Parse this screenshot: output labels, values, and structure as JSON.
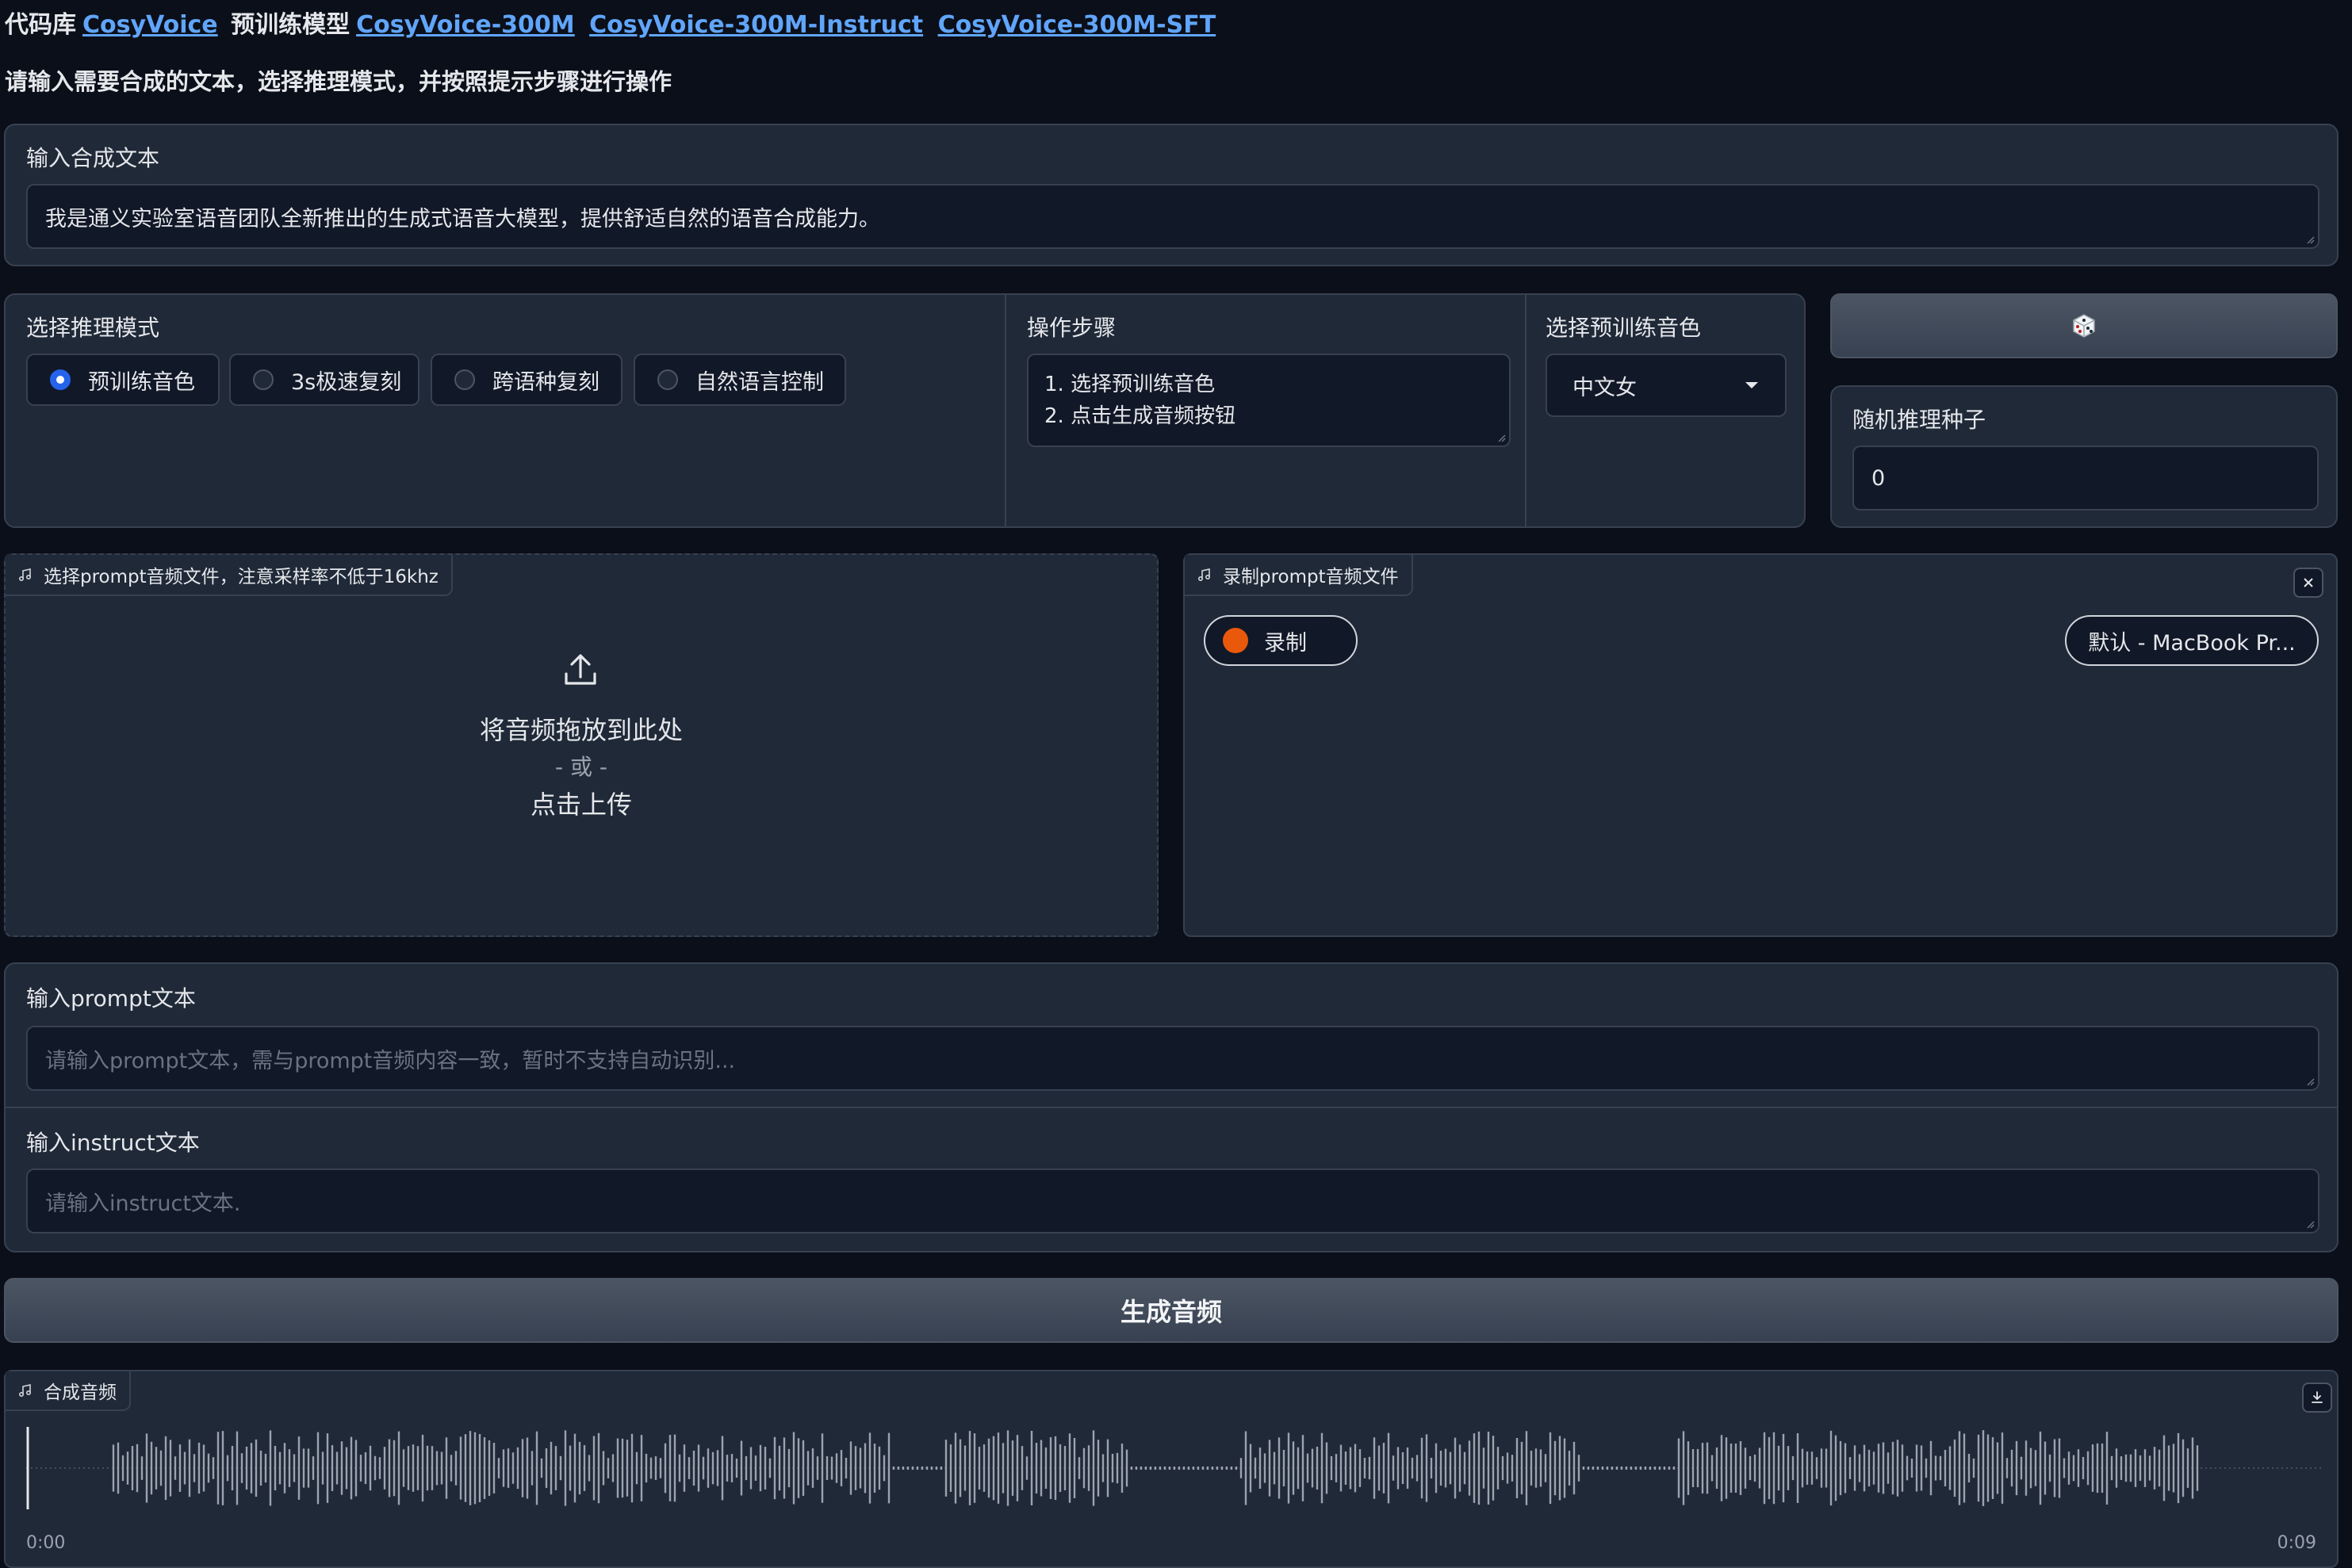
{
  "header": {
    "repo_label": "代码库",
    "repo_link": "CosyVoice",
    "pretrained_label": "预训练模型",
    "model_links": [
      "CosyVoice-300M",
      "CosyVoice-300M-Instruct",
      "CosyVoice-300M-SFT"
    ],
    "instruction": "请输入需要合成的文本，选择推理模式，并按照提示步骤进行操作"
  },
  "synth_text": {
    "label": "输入合成文本",
    "value": "我是通义实验室语音团队全新推出的生成式语音大模型，提供舒适自然的语音合成能力。"
  },
  "mode": {
    "label": "选择推理模式",
    "options": [
      "预训练音色",
      "3s极速复刻",
      "跨语种复刻",
      "自然语言控制"
    ],
    "selected": "预训练音色"
  },
  "steps": {
    "label": "操作步骤",
    "lines": [
      "1. 选择预训练音色",
      "2. 点击生成音频按钮"
    ]
  },
  "voice": {
    "label": "选择预训练音色",
    "value": "中文女"
  },
  "dice_icon": "dice-icon",
  "seed": {
    "label": "随机推理种子",
    "value": "0"
  },
  "prompt_upload": {
    "tag": "选择prompt音频文件，注意采样率不低于16khz",
    "drop_text": "将音频拖放到此处",
    "or_text": "- 或 -",
    "click_text": "点击上传"
  },
  "prompt_record": {
    "tag": "录制prompt音频文件",
    "record_label": "录制",
    "device": "默认 - MacBook Pr..."
  },
  "prompt_text": {
    "label": "输入prompt文本",
    "placeholder": "请输入prompt文本，需与prompt音频内容一致，暂时不支持自动识别..."
  },
  "instruct_text": {
    "label": "输入instruct文本",
    "placeholder": "请输入instruct文本."
  },
  "generate_label": "生成音频",
  "output_audio": {
    "tag": "合成音频",
    "time_start": "0:00",
    "time_end": "0:09"
  },
  "colors": {
    "background": "#0b0f19",
    "panel": "#1f2937",
    "link": "#60a5fa",
    "radio_selected": "#2563eb",
    "record_dot": "#ea580c"
  }
}
